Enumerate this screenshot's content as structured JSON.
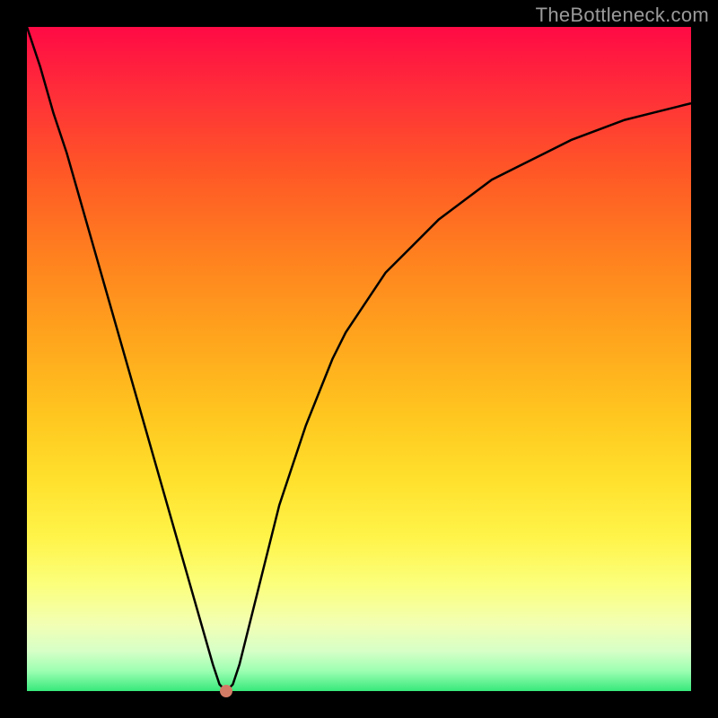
{
  "watermark": "TheBottleneck.com",
  "colors": {
    "frame": "#000000",
    "curve": "#000000",
    "min_marker": "#d47b66",
    "gradient_top": "#ff0a45",
    "gradient_bottom": "#37e87b"
  },
  "chart_data": {
    "type": "line",
    "title": "",
    "xlabel": "",
    "ylabel": "",
    "xlim": [
      0,
      100
    ],
    "ylim": [
      0,
      100
    ],
    "x": [
      0,
      2,
      4,
      6,
      8,
      10,
      12,
      14,
      16,
      18,
      20,
      22,
      24,
      26,
      28,
      29,
      30,
      31,
      32,
      34,
      36,
      38,
      40,
      42,
      44,
      46,
      48,
      50,
      54,
      58,
      62,
      66,
      70,
      74,
      78,
      82,
      86,
      90,
      94,
      98,
      100
    ],
    "values": [
      100,
      94,
      87,
      81,
      74,
      67,
      60,
      53,
      46,
      39,
      32,
      25,
      18,
      11,
      4,
      1,
      0,
      1,
      4,
      12,
      20,
      28,
      34,
      40,
      45,
      50,
      54,
      57,
      63,
      67,
      71,
      74,
      77,
      79,
      81,
      83,
      84.5,
      86,
      87,
      88,
      88.5
    ],
    "min_point": {
      "x": 30,
      "y": 0
    },
    "grid": false,
    "legend": false
  }
}
